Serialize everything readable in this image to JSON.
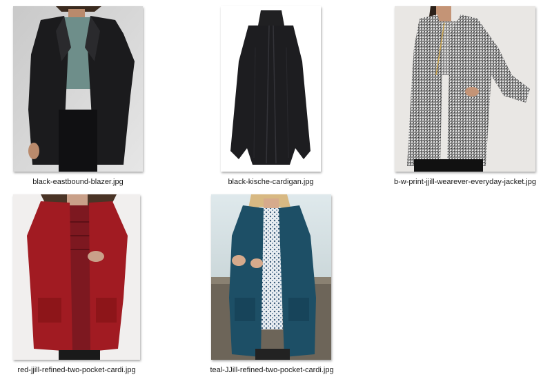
{
  "files": [
    {
      "name": "black-eastbound-blazer.jpg"
    },
    {
      "name": "black-kische-cardigan.jpg"
    },
    {
      "name": "b-w-print-jjill-wearever-everyday-jacket.jpg"
    },
    {
      "name": "red-jjill-refined-two-pocket-cardi.jpg"
    },
    {
      "name": "teal-JJill-refined-two-pocket-cardi.jpg"
    }
  ]
}
